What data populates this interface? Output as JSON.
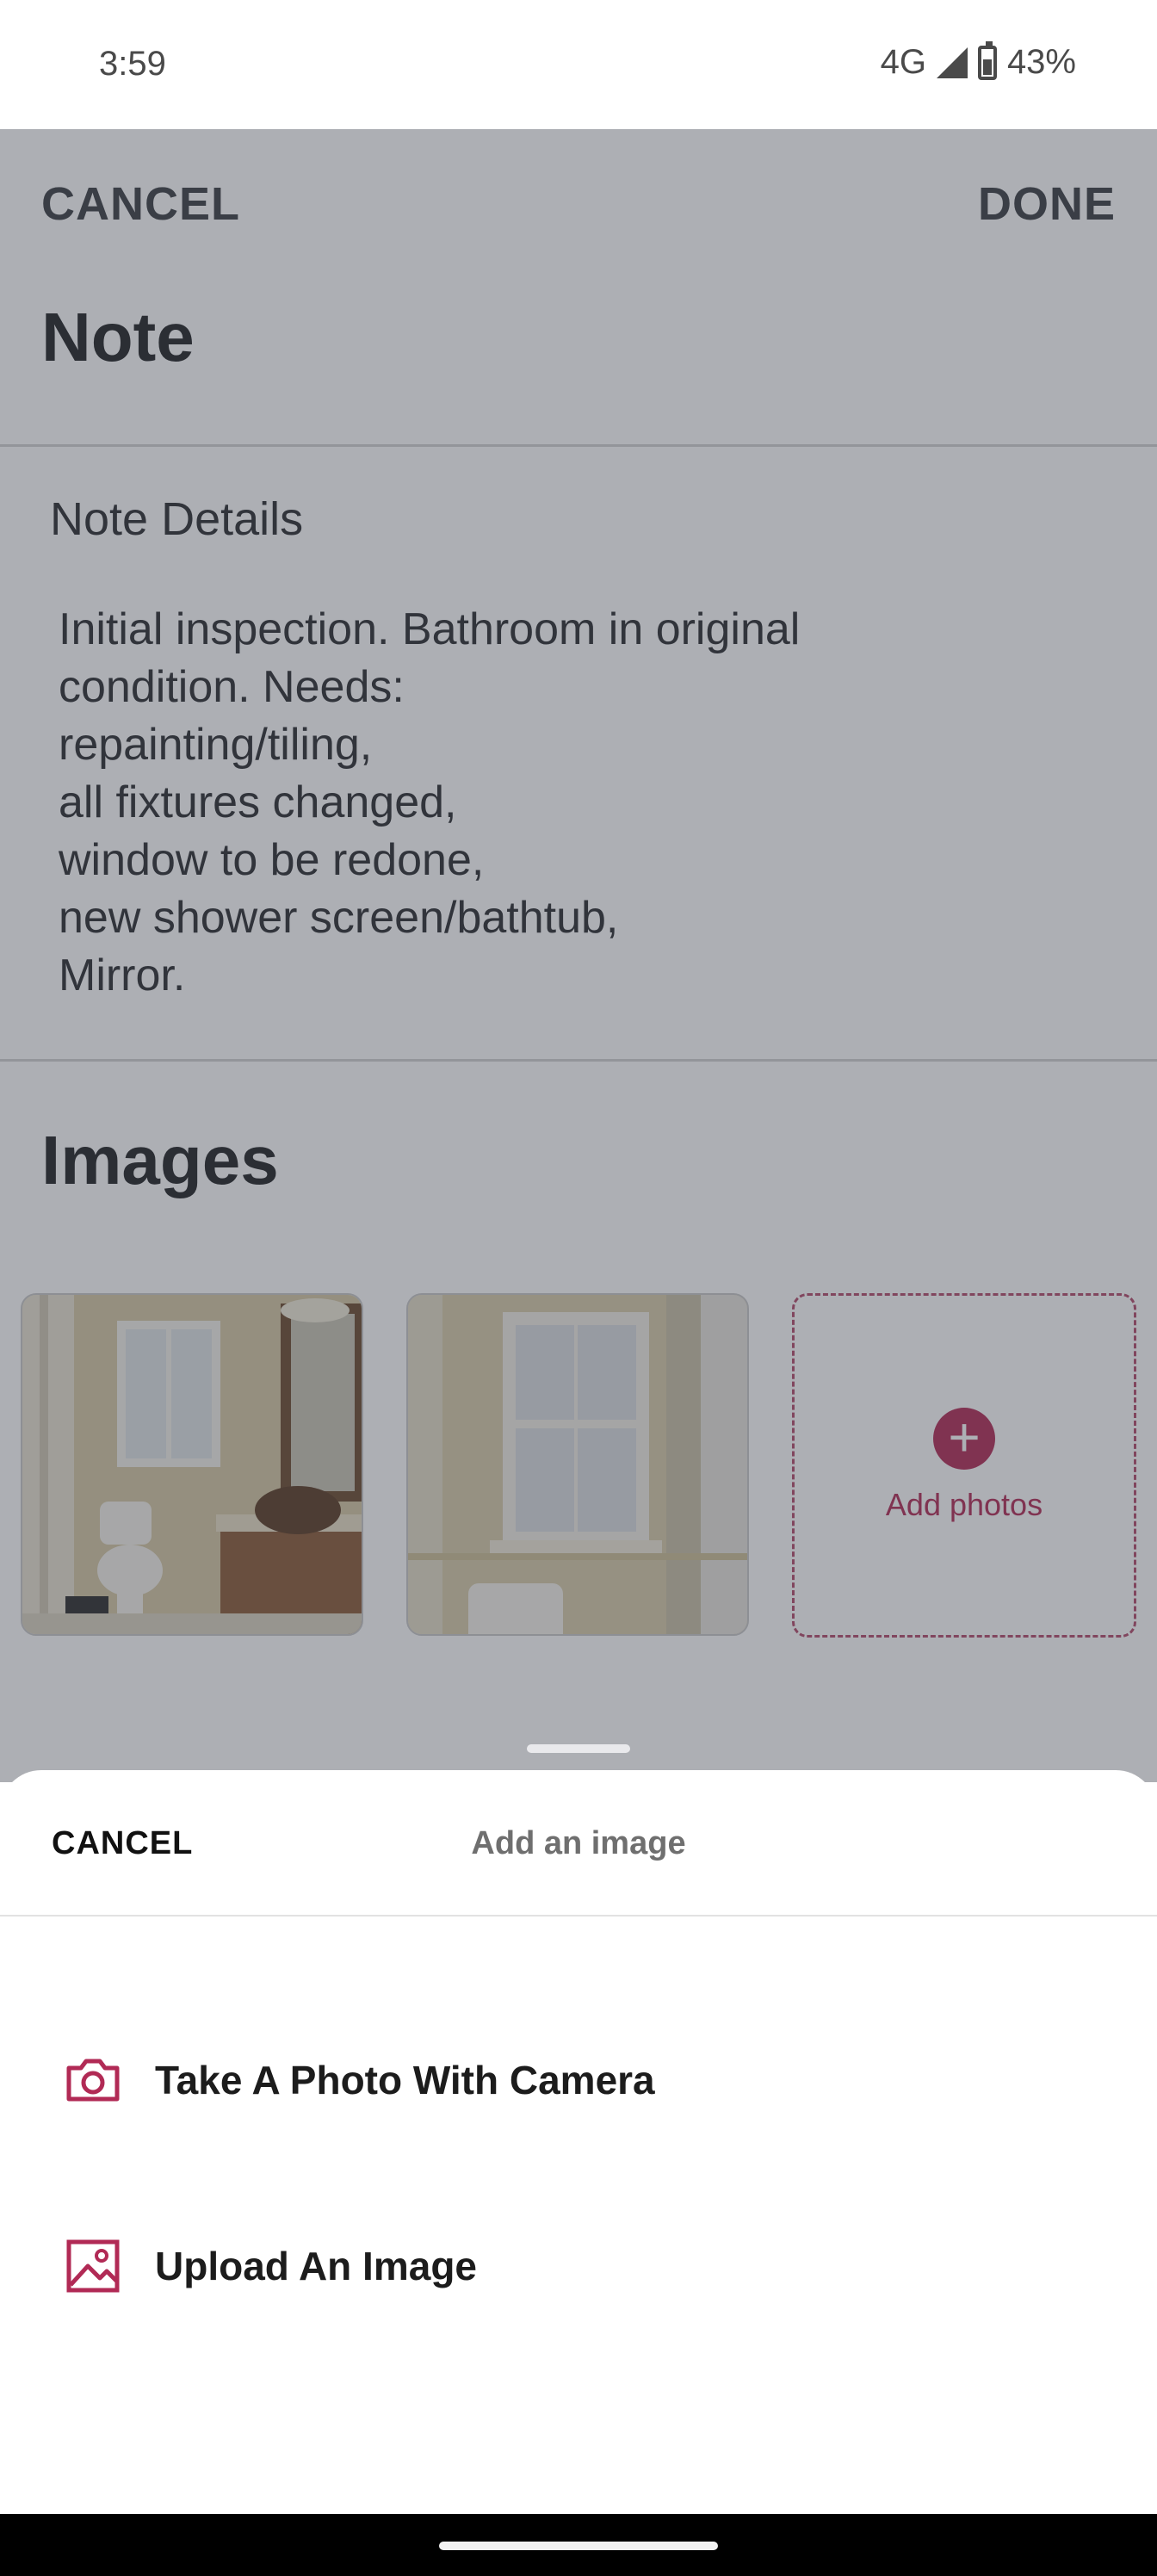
{
  "status_bar": {
    "time": "3:59",
    "network": "4G",
    "battery": "43%"
  },
  "header": {
    "cancel_label": "CANCEL",
    "done_label": "DONE",
    "title": "Note"
  },
  "note_details": {
    "label": "Note Details",
    "text": "Initial inspection. Bathroom in original\ncondition. Needs:\nrepainting/tiling,\nall fixtures changed,\nwindow to be redone,\nnew shower screen/bathtub,\nMirror."
  },
  "images": {
    "title": "Images",
    "thumbnails": [
      "bathroom-photo-1",
      "bathroom-photo-2"
    ],
    "add_label": "Add photos",
    "add_icon": "+"
  },
  "sheet": {
    "cancel_label": "CANCEL",
    "title": "Add an image",
    "options": [
      {
        "label": "Take A Photo With Camera",
        "icon": "camera-icon"
      },
      {
        "label": "Upload An Image",
        "icon": "image-icon"
      }
    ]
  },
  "colors": {
    "accent": "#b12a55",
    "scrim": "#3c404c"
  }
}
